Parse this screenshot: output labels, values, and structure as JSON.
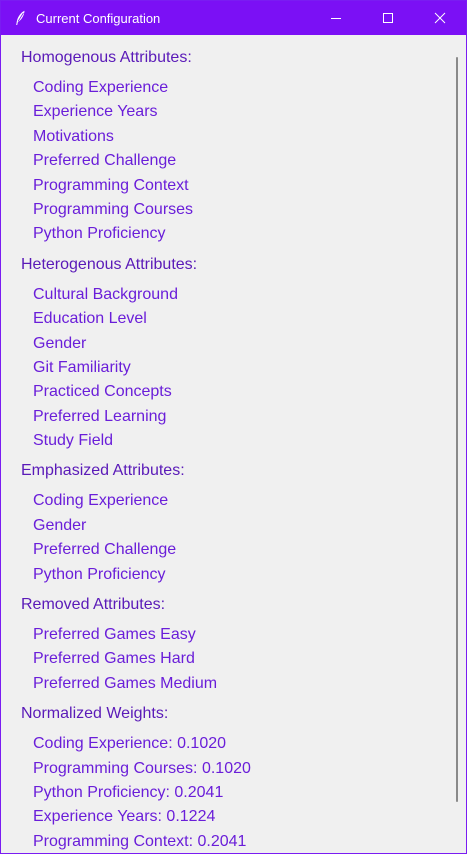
{
  "window": {
    "title": "Current Configuration"
  },
  "sections": [
    {
      "header": "Homogenous Attributes:",
      "items": [
        "Coding Experience",
        "Experience Years",
        "Motivations",
        "Preferred Challenge",
        "Programming Context",
        "Programming Courses",
        "Python Proficiency"
      ]
    },
    {
      "header": "Heterogenous Attributes:",
      "items": [
        "Cultural Background",
        "Education Level",
        "Gender",
        "Git Familiarity",
        "Practiced Concepts",
        "Preferred Learning",
        "Study Field"
      ]
    },
    {
      "header": "Emphasized Attributes:",
      "items": [
        "Coding Experience",
        "Gender",
        "Preferred Challenge",
        "Python Proficiency"
      ]
    },
    {
      "header": "Removed Attributes:",
      "items": [
        "Preferred Games Easy",
        "Preferred Games Hard",
        "Preferred Games Medium"
      ]
    },
    {
      "header": "Normalized Weights:",
      "items": [
        "Coding Experience: 0.1020",
        "Programming Courses: 0.1020",
        "Python Proficiency: 0.2041",
        "Experience Years: 0.1224",
        "Programming Context: 0.2041"
      ]
    }
  ],
  "colors": {
    "titlebar": "#7b10f5",
    "section_header": "#5a1ab8",
    "item_text": "#6a1ed9",
    "background": "#f0f0f0"
  }
}
